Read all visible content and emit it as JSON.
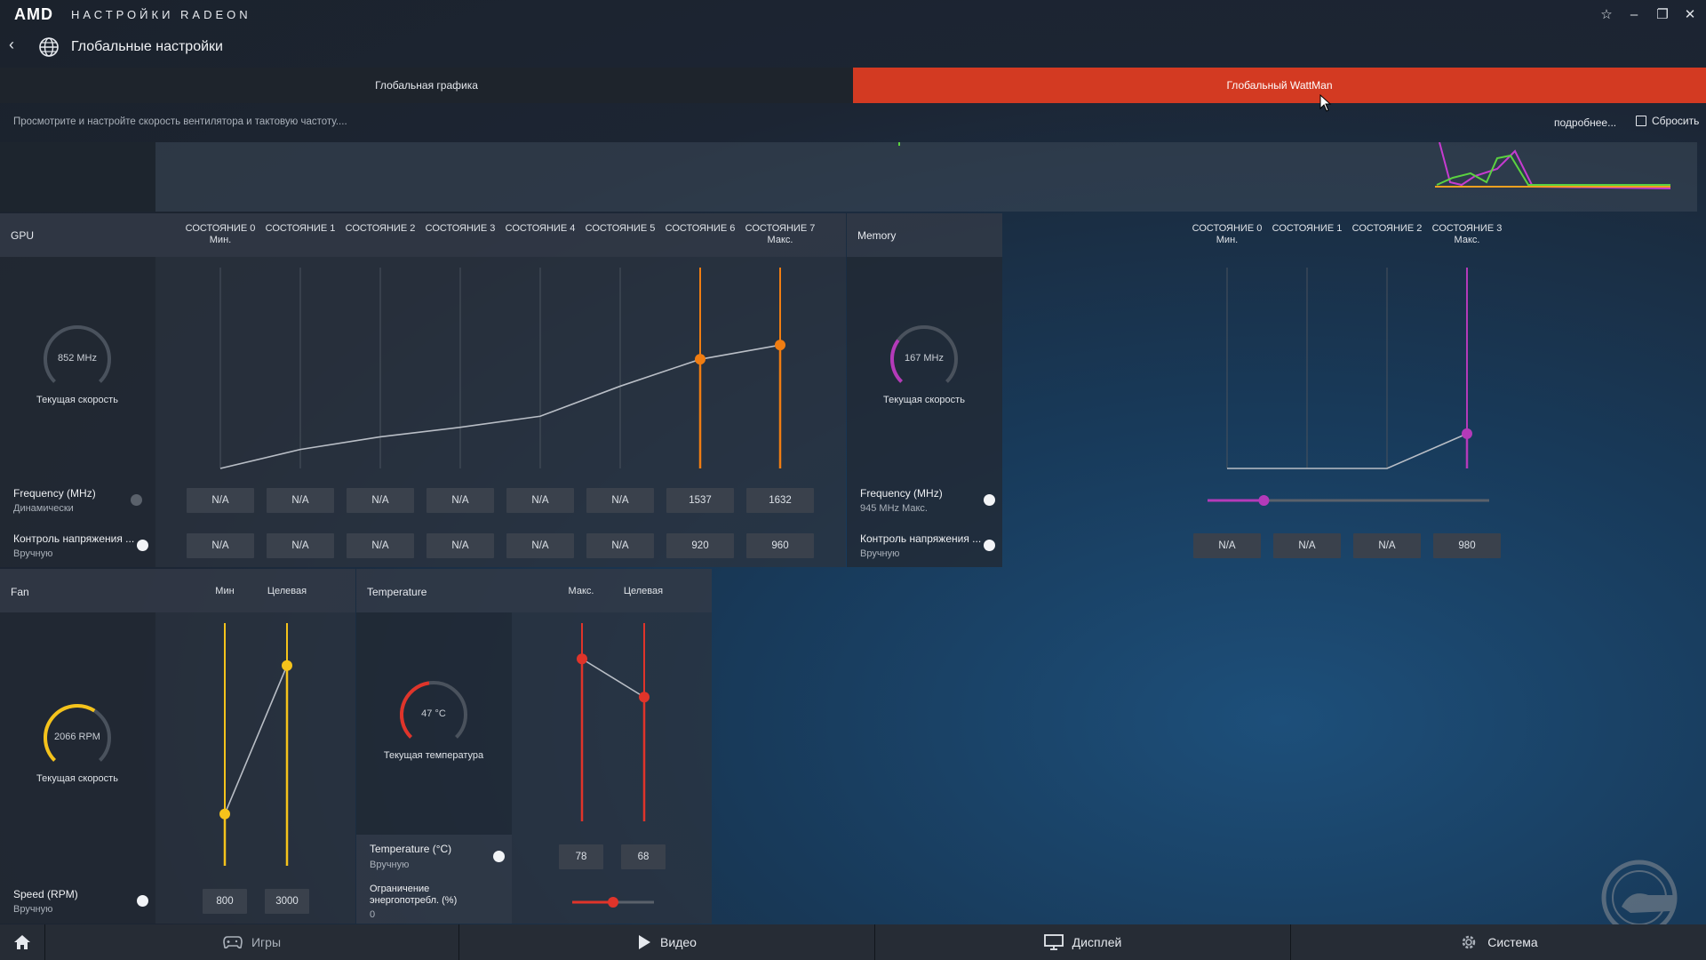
{
  "app": {
    "brand": "AMD",
    "title": "НАСТРОЙКИ RADEON"
  },
  "nav": {
    "page_title": "Глобальные настройки"
  },
  "tabs": [
    {
      "label": "Глобальная графика",
      "active": false
    },
    {
      "label": "Глобальный WattMan",
      "active": true
    }
  ],
  "subheader": {
    "description": "Просмотрите и настройте скорость вентилятора и тактовую частоту....",
    "details": "подробнее...",
    "reset": "Сбросить"
  },
  "gpu": {
    "title": "GPU",
    "states": [
      {
        "label": "СОСТОЯНИЕ 0",
        "sub": "Мин."
      },
      {
        "label": "СОСТОЯНИЕ 1",
        "sub": ""
      },
      {
        "label": "СОСТОЯНИЕ 2",
        "sub": ""
      },
      {
        "label": "СОСТОЯНИЕ 3",
        "sub": ""
      },
      {
        "label": "СОСТОЯНИЕ 4",
        "sub": ""
      },
      {
        "label": "СОСТОЯНИЕ 5",
        "sub": ""
      },
      {
        "label": "СОСТОЯНИЕ 6",
        "sub": ""
      },
      {
        "label": "СОСТОЯНИЕ 7",
        "sub": "Макс."
      }
    ],
    "gauge_value": "852 MHz",
    "gauge_label": "Текущая скорость",
    "gauge_fraction": 0.0,
    "frequency": {
      "title": "Frequency (MHz)",
      "mode": "Динамически",
      "enabled": false,
      "values": [
        "N/A",
        "N/A",
        "N/A",
        "N/A",
        "N/A",
        "N/A",
        "1537",
        "1632"
      ]
    },
    "voltage": {
      "title": "Контроль напряжения ...",
      "mode": "Вручную",
      "enabled": true,
      "values": [
        "N/A",
        "N/A",
        "N/A",
        "N/A",
        "N/A",
        "N/A",
        "920",
        "960"
      ]
    },
    "curve_levels": [
      0.0,
      0.12,
      0.2,
      0.26,
      0.33,
      0.52,
      0.69,
      0.78
    ],
    "accent": "#f07d12"
  },
  "memory": {
    "title": "Memory",
    "states": [
      {
        "label": "СОСТОЯНИЕ 0",
        "sub": "Мин."
      },
      {
        "label": "СОСТОЯНИЕ 1",
        "sub": ""
      },
      {
        "label": "СОСТОЯНИЕ 2",
        "sub": ""
      },
      {
        "label": "СОСТОЯНИЕ 3",
        "sub": "Макс."
      }
    ],
    "gauge_value": "167 MHz",
    "gauge_label": "Текущая скорость",
    "gauge_fraction": 0.3,
    "frequency": {
      "title": "Frequency (MHz)",
      "mode": "945 MHz Макс.",
      "enabled": true,
      "slider_fraction": 0.2
    },
    "voltage": {
      "title": "Контроль напряжения ...",
      "mode": "Вручную",
      "enabled": true,
      "values": [
        "N/A",
        "N/A",
        "N/A",
        "980"
      ]
    },
    "curve_levels": [
      0.0,
      0.0,
      0.0,
      0.22
    ],
    "accent": "#b43ab9"
  },
  "fan": {
    "title": "Fan",
    "columns": [
      "Мин",
      "Целевая"
    ],
    "gauge_value": "2066 RPM",
    "gauge_label": "Текущая скорость",
    "gauge_fraction": 0.62,
    "speed": {
      "title": "Speed (RPM)",
      "mode": "Вручную",
      "enabled": true,
      "values": [
        "800",
        "3000"
      ]
    },
    "curve_levels": [
      0.22,
      0.85
    ],
    "accent": "#f5c31b"
  },
  "temperature": {
    "title": "Temperature",
    "columns": [
      "Макс.",
      "Целевая"
    ],
    "gauge_value": "47 °C",
    "gauge_label": "Текущая температура",
    "gauge_fraction": 0.47,
    "temp": {
      "title": "Temperature (°C)",
      "mode": "Вручную",
      "enabled": true,
      "values": [
        "78",
        "68"
      ]
    },
    "power": {
      "title_line1": "Ограничение",
      "title_line2": "энергопотребл. (%)",
      "value": "0",
      "slider_fraction": 0.5
    },
    "curve_levels": [
      0.85,
      0.65
    ],
    "accent": "#e0342a"
  },
  "bottom_nav": [
    {
      "label": "Игры",
      "icon": "gamepad-icon"
    },
    {
      "label": "Видео",
      "icon": "play-icon"
    },
    {
      "label": "Дисплей",
      "icon": "monitor-icon"
    },
    {
      "label": "Система",
      "icon": "gear-icon"
    }
  ]
}
